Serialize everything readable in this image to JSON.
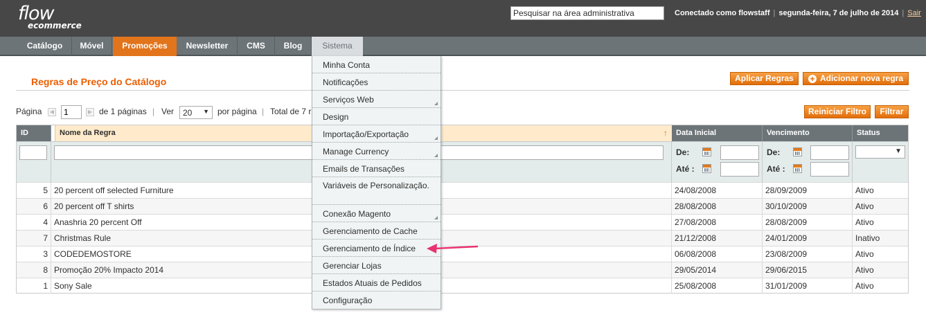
{
  "header": {
    "logo_main": "flow",
    "logo_sub": "ecommerce",
    "search_placeholder": "Pesquisar na área administrativa",
    "logged_in": "Conectado como flowstaff",
    "date": "segunda-feira, 7 de julho de 2014",
    "logout": "Sair"
  },
  "nav": {
    "items": [
      {
        "label": "Catálogo"
      },
      {
        "label": "Móvel"
      },
      {
        "label": "Promoções"
      },
      {
        "label": "Newsletter"
      },
      {
        "label": "CMS"
      },
      {
        "label": "Blog"
      },
      {
        "label": "Sistema"
      }
    ],
    "active": "Promoções",
    "open": "Sistema"
  },
  "system_menu": [
    {
      "label": "Minha Conta",
      "has_submenu": false
    },
    {
      "label": "Notificações",
      "has_submenu": false
    },
    {
      "label": "Serviços Web",
      "has_submenu": true
    },
    {
      "label": "Design",
      "has_submenu": false
    },
    {
      "label": "Importação/Exportação",
      "has_submenu": true
    },
    {
      "label": "Manage Currency",
      "has_submenu": true
    },
    {
      "label": "Emails de Transações",
      "has_submenu": false
    },
    {
      "label": "Variáveis de Personalização.",
      "has_submenu": false
    },
    {
      "label": "Conexão Magento",
      "has_submenu": true
    },
    {
      "label": "Gerenciamento de Cache",
      "has_submenu": false
    },
    {
      "label": "Gerenciamento de Índice",
      "has_submenu": false
    },
    {
      "label": "Gerenciar Lojas",
      "has_submenu": false
    },
    {
      "label": "Estados Atuais de Pedidos",
      "has_submenu": false
    },
    {
      "label": "Configuração",
      "has_submenu": false
    }
  ],
  "page": {
    "title": "Regras de Preço do Catálogo",
    "apply_rules": "Aplicar Regras",
    "add_rule": "Adicionar nova regra",
    "reset_filter": "Reiniciar Filtro",
    "filter": "Filtrar"
  },
  "pager": {
    "page_label": "Página",
    "page_value": "1",
    "of_pages": "de 1 páginas",
    "view_label": "Ver",
    "per_page_value": "20",
    "per_page_label": "por página",
    "total": "Total de 7 r"
  },
  "grid": {
    "columns": [
      "ID",
      "Nome da Regra",
      "Data Inicial",
      "Vencimento",
      "Status"
    ],
    "filter_from": "De:",
    "filter_to": "Até :",
    "rows": [
      {
        "id": "5",
        "name": "20 percent off selected Furniture",
        "start": "24/08/2008",
        "end": "28/09/2009",
        "status": "Ativo"
      },
      {
        "id": "6",
        "name": "20 percent off T shirts",
        "start": "28/08/2008",
        "end": "30/10/2009",
        "status": "Ativo"
      },
      {
        "id": "4",
        "name": "Anashria 20 percent Off",
        "start": "27/08/2008",
        "end": "28/08/2009",
        "status": "Ativo"
      },
      {
        "id": "7",
        "name": "Christmas Rule",
        "start": "21/12/2008",
        "end": "24/01/2009",
        "status": "Inativo"
      },
      {
        "id": "3",
        "name": "CODEDEMOSTORE",
        "start": "06/08/2008",
        "end": "23/08/2009",
        "status": "Ativo"
      },
      {
        "id": "8",
        "name": "Promoção 20% Impacto 2014",
        "start": "29/05/2014",
        "end": "29/06/2015",
        "status": "Ativo"
      },
      {
        "id": "1",
        "name": "Sony Sale",
        "start": "25/08/2008",
        "end": "31/01/2009",
        "status": "Ativo"
      }
    ]
  },
  "colors": {
    "accent": "#e26e0b",
    "title": "#eb5e00",
    "nav_bg": "#6c7478",
    "header_bg": "#474747",
    "pointer": "#e8336f"
  }
}
